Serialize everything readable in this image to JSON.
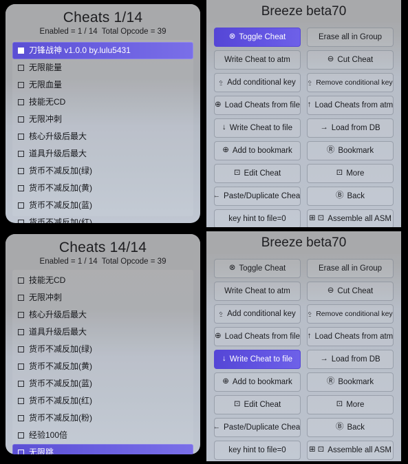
{
  "colors": {
    "accent": "#6254e2",
    "panel_head": "#a8a9ab",
    "panel_body": "#bcc3ce",
    "text": "#1a1b1f",
    "backdrop": "#000000"
  },
  "panels": {
    "cheats_top": {
      "title": "Cheats 1/14",
      "subtitle": "Enabled = 1 / 14  Total Opcode = 39",
      "rows": [
        {
          "label": "刀锋战神 v1.0.0 by.lulu5431",
          "checked": true,
          "selected": true
        },
        {
          "label": "无限能量",
          "checked": false,
          "selected": false
        },
        {
          "label": "无限血量",
          "checked": false,
          "selected": false
        },
        {
          "label": "技能无CD",
          "checked": false,
          "selected": false
        },
        {
          "label": "无限冲刺",
          "checked": false,
          "selected": false
        },
        {
          "label": "核心升级后最大",
          "checked": false,
          "selected": false
        },
        {
          "label": "道具升级后最大",
          "checked": false,
          "selected": false
        },
        {
          "label": "货币不减反加(绿)",
          "checked": false,
          "selected": false
        },
        {
          "label": "货币不减反加(黄)",
          "checked": false,
          "selected": false
        },
        {
          "label": "货币不减反加(蓝)",
          "checked": false,
          "selected": false
        },
        {
          "label": "货币不减反加(红)",
          "checked": false,
          "selected": false
        }
      ]
    },
    "cheats_bottom": {
      "title": "Cheats 14/14",
      "subtitle": "Enabled = 1 / 14  Total Opcode = 39",
      "rows": [
        {
          "label": "技能无CD",
          "checked": false,
          "selected": false
        },
        {
          "label": "无限冲刺",
          "checked": false,
          "selected": false
        },
        {
          "label": "核心升级后最大",
          "checked": false,
          "selected": false
        },
        {
          "label": "道具升级后最大",
          "checked": false,
          "selected": false
        },
        {
          "label": "货币不减反加(绿)",
          "checked": false,
          "selected": false
        },
        {
          "label": "货币不减反加(黄)",
          "checked": false,
          "selected": false
        },
        {
          "label": "货币不减反加(蓝)",
          "checked": false,
          "selected": false
        },
        {
          "label": "货币不减反加(红)",
          "checked": false,
          "selected": false
        },
        {
          "label": "货币不减反加(粉)",
          "checked": false,
          "selected": false
        },
        {
          "label": "经验100倍",
          "checked": false,
          "selected": false
        },
        {
          "label": "无限跳",
          "checked": false,
          "selected": true
        }
      ]
    },
    "menu_top": {
      "title": "Breeze beta70",
      "selected_index": 0,
      "buttons": [
        {
          "label": "Toggle Cheat",
          "icons": [
            "⊗"
          ],
          "icon_names": [
            "circle-x-icon"
          ]
        },
        {
          "label": "Erase all in Group",
          "icons": [],
          "icon_names": []
        },
        {
          "label": "Write Cheat to atm",
          "icons": [],
          "icon_names": []
        },
        {
          "label": "Cut Cheat",
          "icons": [
            "⊖"
          ],
          "icon_names": [
            "circle-minus-icon"
          ]
        },
        {
          "label": "Add conditional key",
          "icons": [
            "⍚"
          ],
          "icon_names": [
            "thumbstick-icon"
          ]
        },
        {
          "label": "Remove conditional key",
          "icons": [
            "⍚"
          ],
          "icon_names": [
            "thumbstick-icon"
          ],
          "small": true
        },
        {
          "label": "Load Cheats from file",
          "icons": [
            "⊕"
          ],
          "icon_names": [
            "circle-clock-icon"
          ]
        },
        {
          "label": "Load Cheats from atm",
          "icons": [
            "↑"
          ],
          "icon_names": [
            "arrow-up-icon"
          ]
        },
        {
          "label": "Write Cheat to file",
          "icons": [
            "↓"
          ],
          "icon_names": [
            "arrow-down-icon"
          ]
        },
        {
          "label": "Load from DB",
          "icons": [
            "→"
          ],
          "icon_names": [
            "arrow-right-icon"
          ]
        },
        {
          "label": "Add to bookmark",
          "icons": [
            "⊕"
          ],
          "icon_names": [
            "circle-plus-icon"
          ]
        },
        {
          "label": "Bookmark",
          "icons": [
            "Ⓡ"
          ],
          "icon_names": [
            "boxed-r-icon"
          ]
        },
        {
          "label": "Edit Cheat",
          "icons": [
            "⊡"
          ],
          "icon_names": [
            "boxed-a-icon"
          ]
        },
        {
          "label": "More",
          "icons": [
            "⊡"
          ],
          "icon_names": [
            "boxed-m-icon"
          ]
        },
        {
          "label": "Paste/Duplicate Cheat",
          "icons": [
            "←"
          ],
          "icon_names": [
            "arrow-left-icon"
          ]
        },
        {
          "label": "Back",
          "icons": [
            "Ⓑ"
          ],
          "icon_names": [
            "circle-b-icon"
          ]
        },
        {
          "label": "key hint to file=0",
          "icons": [],
          "icon_names": []
        },
        {
          "label": "Assemble all ASM",
          "icons": [
            "⊞",
            "⊡"
          ],
          "icon_names": [
            "boxed-l-icon",
            "boxed-a-icon"
          ]
        }
      ]
    },
    "menu_bottom": {
      "title": "Breeze beta70",
      "selected_index": 8,
      "buttons": [
        {
          "label": "Toggle Cheat",
          "icons": [
            "⊗"
          ],
          "icon_names": [
            "circle-x-icon"
          ]
        },
        {
          "label": "Erase all in Group",
          "icons": [],
          "icon_names": []
        },
        {
          "label": "Write Cheat to atm",
          "icons": [],
          "icon_names": []
        },
        {
          "label": "Cut Cheat",
          "icons": [
            "⊖"
          ],
          "icon_names": [
            "circle-minus-icon"
          ]
        },
        {
          "label": "Add conditional key",
          "icons": [
            "⍚"
          ],
          "icon_names": [
            "thumbstick-icon"
          ]
        },
        {
          "label": "Remove conditional key",
          "icons": [
            "⍚"
          ],
          "icon_names": [
            "thumbstick-icon"
          ],
          "small": true
        },
        {
          "label": "Load Cheats from file",
          "icons": [
            "⊕"
          ],
          "icon_names": [
            "circle-clock-icon"
          ]
        },
        {
          "label": "Load Cheats from atm",
          "icons": [
            "↑"
          ],
          "icon_names": [
            "arrow-up-icon"
          ]
        },
        {
          "label": "Write Cheat to file",
          "icons": [
            "↓"
          ],
          "icon_names": [
            "arrow-down-icon"
          ]
        },
        {
          "label": "Load from DB",
          "icons": [
            "→"
          ],
          "icon_names": [
            "arrow-right-icon"
          ]
        },
        {
          "label": "Add to bookmark",
          "icons": [
            "⊕"
          ],
          "icon_names": [
            "circle-plus-icon"
          ]
        },
        {
          "label": "Bookmark",
          "icons": [
            "Ⓡ"
          ],
          "icon_names": [
            "boxed-r-icon"
          ]
        },
        {
          "label": "Edit Cheat",
          "icons": [
            "⊡"
          ],
          "icon_names": [
            "boxed-a-icon"
          ]
        },
        {
          "label": "More",
          "icons": [
            "⊡"
          ],
          "icon_names": [
            "boxed-m-icon"
          ]
        },
        {
          "label": "Paste/Duplicate Cheat",
          "icons": [
            "←"
          ],
          "icon_names": [
            "arrow-left-icon"
          ]
        },
        {
          "label": "Back",
          "icons": [
            "Ⓑ"
          ],
          "icon_names": [
            "circle-b-icon"
          ]
        },
        {
          "label": "key hint to file=0",
          "icons": [],
          "icon_names": []
        },
        {
          "label": "Assemble all ASM",
          "icons": [
            "⊞",
            "⊡"
          ],
          "icon_names": [
            "boxed-l-icon",
            "boxed-a-icon"
          ]
        }
      ]
    }
  }
}
